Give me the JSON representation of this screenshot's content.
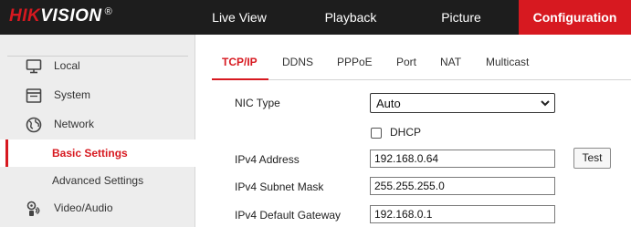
{
  "brand": {
    "part1": "HIK",
    "part2": "VISION",
    "reg_mark": "®"
  },
  "nav": {
    "live_view": "Live View",
    "playback": "Playback",
    "picture": "Picture",
    "configuration": "Configuration",
    "active": "Configuration"
  },
  "sidebar": {
    "items": [
      {
        "label": "Local",
        "icon": "monitor-icon"
      },
      {
        "label": "System",
        "icon": "system-window-icon"
      },
      {
        "label": "Network",
        "icon": "globe-icon"
      },
      {
        "label": "Basic Settings",
        "active": true
      },
      {
        "label": "Advanced Settings"
      },
      {
        "label": "Video/Audio",
        "icon": "video-audio-icon"
      }
    ]
  },
  "tabs": {
    "items": [
      "TCP/IP",
      "DDNS",
      "PPPoE",
      "Port",
      "NAT",
      "Multicast"
    ],
    "active": "TCP/IP"
  },
  "form": {
    "nic_type": {
      "label": "NIC Type",
      "value": "Auto"
    },
    "dhcp": {
      "label": "DHCP",
      "checked": false
    },
    "ipv4_address": {
      "label": "IPv4 Address",
      "value": "192.168.0.64"
    },
    "ipv4_subnet_mask": {
      "label": "IPv4 Subnet Mask",
      "value": "255.255.255.0"
    },
    "ipv4_default_gateway": {
      "label": "IPv4 Default Gateway",
      "value": "192.168.0.1"
    },
    "test_button": "Test"
  },
  "colors": {
    "accent": "#d71920",
    "topbar": "#1d1d1d",
    "sidebar_bg": "#ededed"
  }
}
